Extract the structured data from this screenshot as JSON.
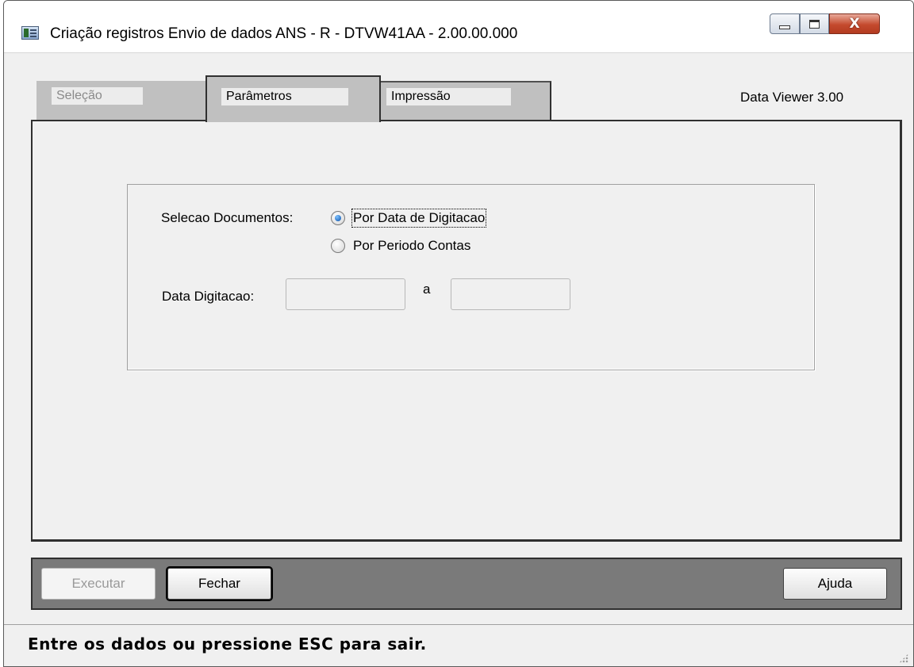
{
  "window": {
    "title": "Criação registros Envio de dados ANS - R - DTVW41AA - 2.00.00.000",
    "controls": {
      "minimize_icon": "minimize-icon",
      "maximize_icon": "maximize-icon",
      "close_glyph": "X"
    }
  },
  "tabs": [
    {
      "label": "Seleção",
      "state": "disabled"
    },
    {
      "label": "Parâmetros",
      "state": "active"
    },
    {
      "label": "Impressão",
      "state": "normal"
    }
  ],
  "version_label": "Data Viewer 3.00",
  "form": {
    "selection_label": "Selecao Documentos:",
    "options": [
      {
        "label": "Por Data de Digitacao",
        "checked": true
      },
      {
        "label": "Por Periodo Contas",
        "checked": false
      }
    ],
    "date_label": "Data Digitacao:",
    "date_from": "",
    "date_separator": "a",
    "date_to": ""
  },
  "buttons": {
    "execute": "Executar",
    "close": "Fechar",
    "help": "Ajuda"
  },
  "status": {
    "message": "Entre os dados ou pressione ESC para sair."
  },
  "colors": {
    "tab_bg": "#c0c0c0",
    "button_bar": "#7a7a7a",
    "radio_selected": "#0a4fa8",
    "close_button": "#c44a2e"
  }
}
